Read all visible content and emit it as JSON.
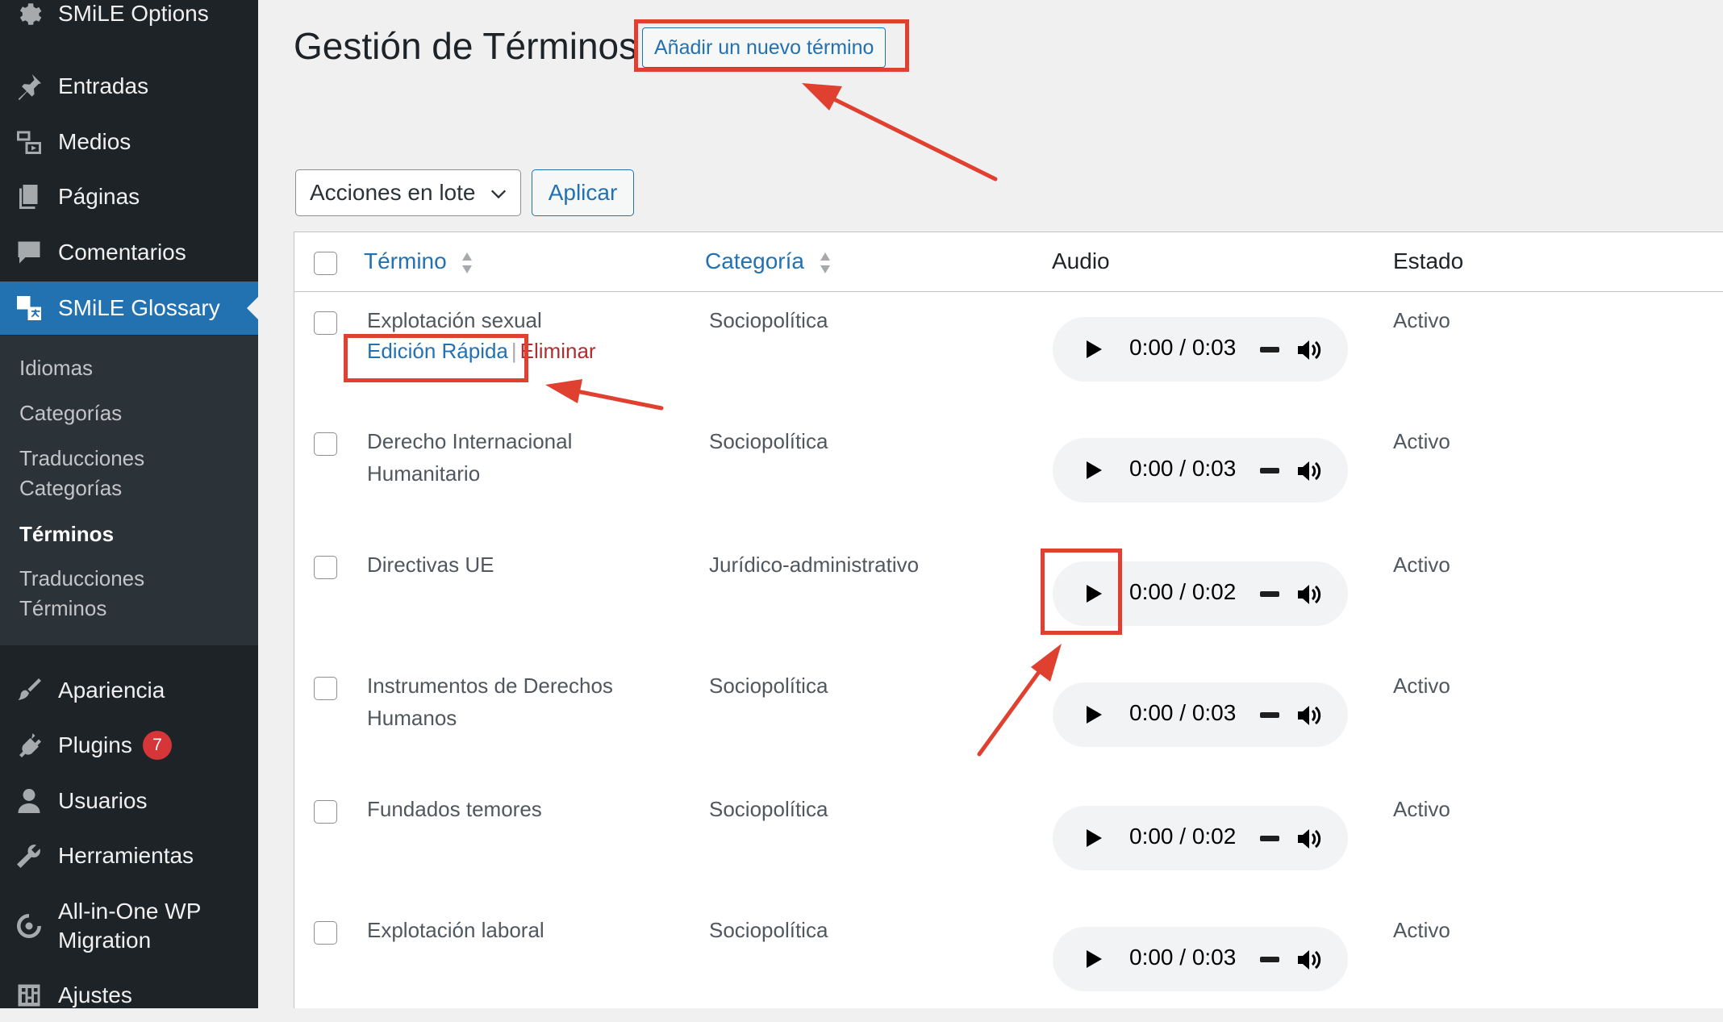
{
  "sidebar": {
    "items": [
      {
        "label": "SMiLE Options",
        "icon": "gear-icon"
      },
      {
        "label": "Entradas",
        "icon": "pin-icon"
      },
      {
        "label": "Medios",
        "icon": "media-icon"
      },
      {
        "label": "Páginas",
        "icon": "pages-icon"
      },
      {
        "label": "Comentarios",
        "icon": "comment-icon"
      },
      {
        "label": "SMiLE Glossary",
        "icon": "translate-icon",
        "active": true
      },
      {
        "label": "Apariencia",
        "icon": "brush-icon"
      },
      {
        "label": "Plugins",
        "icon": "plugin-icon",
        "badge": "7"
      },
      {
        "label": "Usuarios",
        "icon": "user-icon"
      },
      {
        "label": "Herramientas",
        "icon": "wrench-icon"
      },
      {
        "label": "All-in-One WP Migration",
        "label_line1": "All-in-One WP",
        "label_line2": "Migration",
        "icon": "migration-icon"
      },
      {
        "label": "Ajustes",
        "icon": "settings-icon"
      }
    ],
    "submenu": {
      "idiomas": "Idiomas",
      "categorias": "Categorías",
      "trad_cat_1": "Traducciones",
      "trad_cat_2": "Categorías",
      "terminos": "Términos",
      "trad_term_1": "Traducciones",
      "trad_term_2": "Términos"
    }
  },
  "header": {
    "title": "Gestión de Términos",
    "add_new": "Añadir un nuevo término"
  },
  "toolbar": {
    "bulk_actions": "Acciones en lote",
    "apply": "Aplicar"
  },
  "table": {
    "columns": {
      "term": "Término",
      "category": "Categoría",
      "audio": "Audio",
      "status": "Estado"
    },
    "row_actions": {
      "edit": "Edición Rápida",
      "sep": "|",
      "delete": "Eliminar"
    },
    "rows": [
      {
        "term": "Explotación sexual",
        "category": "Sociopolítica",
        "audio_time": "0:00 / 0:03",
        "status": "Activo"
      },
      {
        "term": "Derecho Internacional Humanitario",
        "category": "Sociopolítica",
        "audio_time": "0:00 / 0:03",
        "status": "Activo"
      },
      {
        "term": "Directivas UE",
        "category": "Jurídico-administrativo",
        "audio_time": "0:00 / 0:02",
        "status": "Activo"
      },
      {
        "term": "Instrumentos de Derechos Humanos",
        "category": "Sociopolítica",
        "audio_time": "0:00 / 0:03",
        "status": "Activo"
      },
      {
        "term": "Fundados temores",
        "category": "Sociopolítica",
        "audio_time": "0:00 / 0:02",
        "status": "Activo"
      },
      {
        "term": "Explotación laboral",
        "category": "Sociopolítica",
        "audio_time": "0:00 / 0:03",
        "status": "Activo"
      }
    ]
  },
  "colors": {
    "sidebar_bg": "#1d2327",
    "submenu_bg": "#2c3338",
    "accent": "#2271b1",
    "annotation_red": "#e0402f",
    "delete_red": "#b32d2e"
  }
}
